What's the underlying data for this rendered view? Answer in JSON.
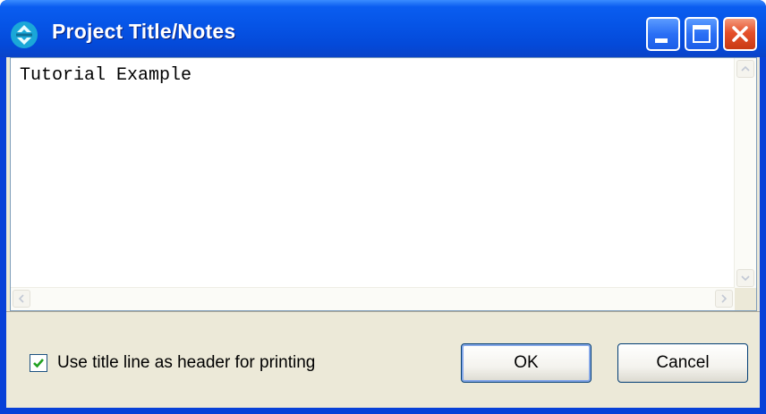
{
  "window": {
    "title": "Project Title/Notes",
    "icon": "project-recycle-icon",
    "controls": [
      "minimize-icon",
      "maximize-icon",
      "close-icon"
    ],
    "colors": {
      "titlebar": "#0654e6",
      "close": "#e5502a",
      "body": "#ece9d8"
    }
  },
  "notes": {
    "text": "Tutorial Example"
  },
  "options": {
    "use_title_header_label": "Use title line as header for printing",
    "use_title_header_checked": true
  },
  "buttons": {
    "ok_label": "OK",
    "cancel_label": "Cancel"
  }
}
